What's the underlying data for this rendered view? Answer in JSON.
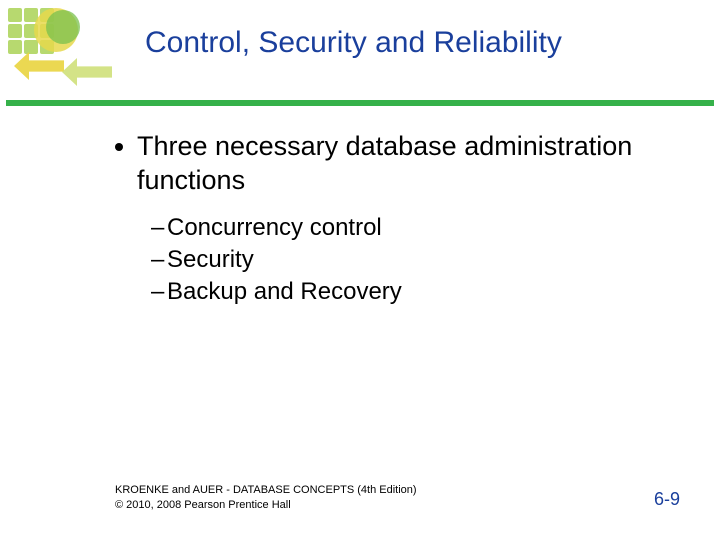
{
  "title": "Control, Security and Reliability",
  "main_bullet": "Three necessary database administration functions",
  "sub_items": {
    "a": "Concurrency control",
    "b": "Security",
    "c": "Backup and Recovery"
  },
  "footer": {
    "line1": "KROENKE and AUER - DATABASE CONCEPTS (4th Edition)",
    "line2": "© 2010, 2008 Pearson Prentice Hall"
  },
  "page_number": "6-9"
}
